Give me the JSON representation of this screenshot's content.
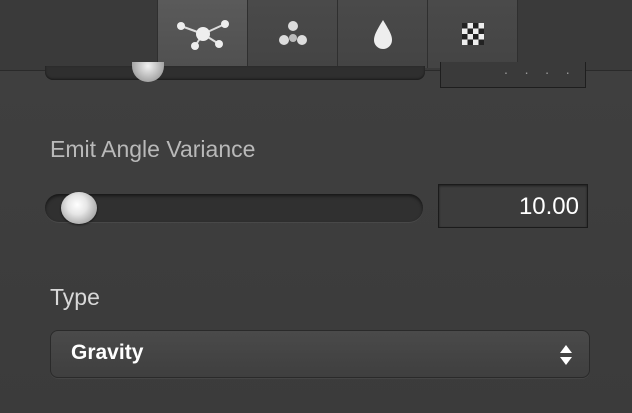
{
  "tabs": [
    {
      "icon": "molecule-icon",
      "active": true
    },
    {
      "icon": "particles-icon",
      "active": false
    },
    {
      "icon": "drop-icon",
      "active": false
    },
    {
      "icon": "checker-icon",
      "active": false
    }
  ],
  "prev_field_value": "· · · ·",
  "emit_angle_variance": {
    "label": "Emit Angle Variance",
    "value": "10.00",
    "slider_fraction": 0.03
  },
  "type": {
    "label": "Type",
    "selected": "Gravity"
  }
}
